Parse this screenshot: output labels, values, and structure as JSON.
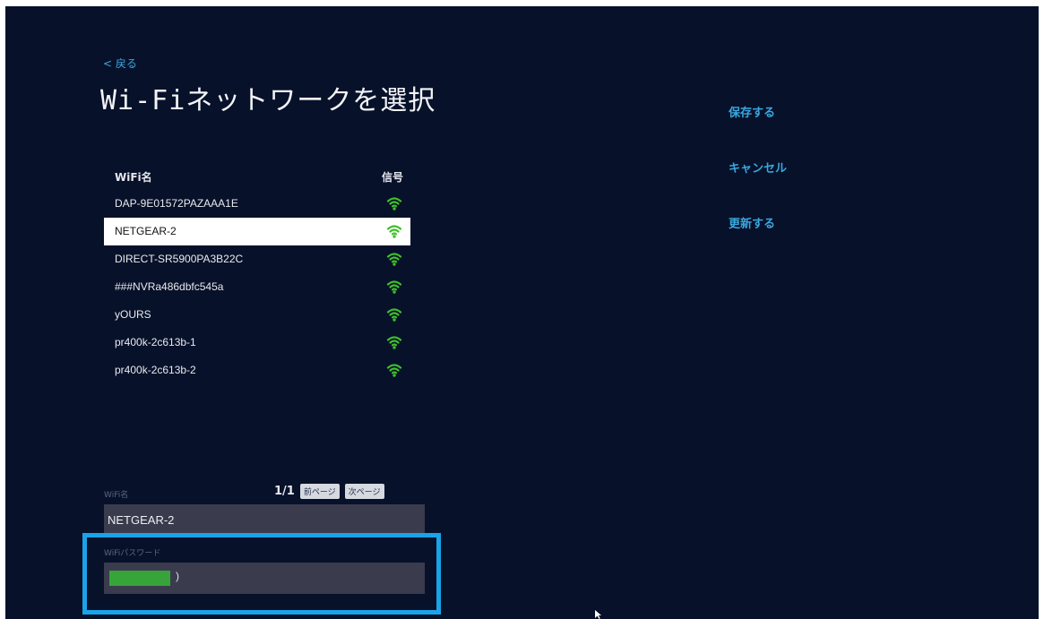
{
  "header": {
    "back_label": "< 戻る",
    "title": "Wi-Fiネットワークを選択"
  },
  "actions": {
    "save": "保存する",
    "cancel": "キャンセル",
    "refresh": "更新する"
  },
  "network_table": {
    "column_name": "WiFi名",
    "column_signal": "信号",
    "rows": [
      {
        "ssid": "DAP-9E01572PAZAAA1E",
        "signal_icon": "wifi-icon",
        "selected": false
      },
      {
        "ssid": "NETGEAR-2",
        "signal_icon": "wifi-icon",
        "selected": true
      },
      {
        "ssid": "DIRECT-SR5900PA3B22C",
        "signal_icon": "wifi-icon",
        "selected": false
      },
      {
        "ssid": "###NVRa486dbfc545a",
        "signal_icon": "wifi-icon",
        "selected": false
      },
      {
        "ssid": "yOURS",
        "signal_icon": "wifi-icon",
        "selected": false
      },
      {
        "ssid": "pr400k-2c613b-1",
        "signal_icon": "wifi-icon",
        "selected": false
      },
      {
        "ssid": "pr400k-2c613b-2",
        "signal_icon": "wifi-icon",
        "selected": false
      }
    ]
  },
  "pagination": {
    "counter": "1/1",
    "prev_label": "前ページ",
    "next_label": "次ページ"
  },
  "form": {
    "ssid_label": "WiFi名",
    "ssid_value": "NETGEAR-2",
    "password_label": "WiFiパスワード",
    "password_cursor": ")"
  },
  "colors": {
    "background": "#07112a",
    "accent": "#3aa7de",
    "signal_green": "#3fbf2a",
    "highlight": "#1aa3e8"
  }
}
